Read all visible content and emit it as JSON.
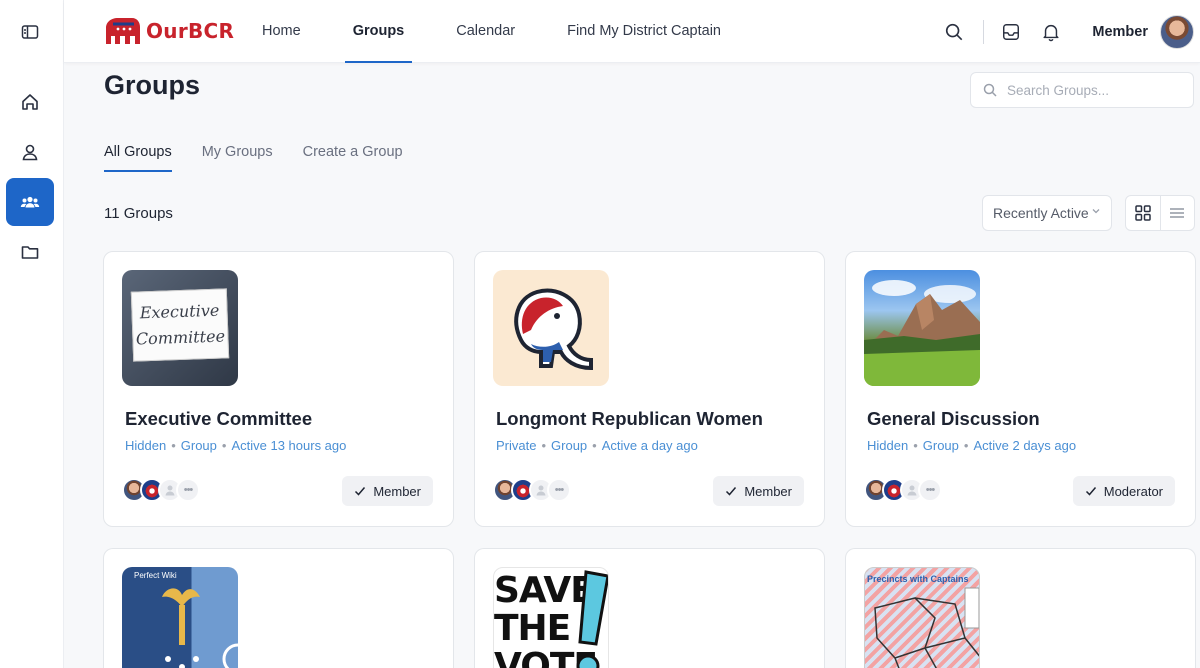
{
  "app": {
    "logo_text": "OurBCR"
  },
  "nav": {
    "items": [
      {
        "label": "Home",
        "active": false
      },
      {
        "label": "Groups",
        "active": true
      },
      {
        "label": "Calendar",
        "active": false
      },
      {
        "label": "Find My District Captain",
        "active": false
      }
    ]
  },
  "user": {
    "name": "Member"
  },
  "sidebar": {
    "items": [
      {
        "icon": "sidebar-toggle-icon"
      },
      {
        "icon": "home-icon"
      },
      {
        "icon": "profile-icon"
      },
      {
        "icon": "groups-icon",
        "active": true
      },
      {
        "icon": "folder-icon"
      }
    ]
  },
  "page": {
    "title": "Groups",
    "search_placeholder": "Search Groups...",
    "tabs": [
      {
        "label": "All Groups",
        "active": true
      },
      {
        "label": "My Groups",
        "active": false
      },
      {
        "label": "Create a Group",
        "active": false
      }
    ],
    "count_label": "11 Groups",
    "sort_label": "Recently Active"
  },
  "groups": [
    {
      "name": "Executive Committee",
      "privacy": "Hidden",
      "type": "Group",
      "activity": "Active 13 hours ago",
      "role": "Member",
      "thumb_text": [
        "Executive",
        "Committee"
      ]
    },
    {
      "name": "Longmont Republican Women",
      "privacy": "Private",
      "type": "Group",
      "activity": "Active a day ago",
      "role": "Member"
    },
    {
      "name": "General Discussion",
      "privacy": "Hidden",
      "type": "Group",
      "activity": "Active 2 days ago",
      "role": "Moderator"
    },
    {
      "thumb_text": [
        "Perfect Wiki"
      ]
    },
    {
      "thumb_text": [
        "SAVE",
        "THE",
        "VOTE"
      ]
    },
    {
      "thumb_text": [
        "Precincts with Captains"
      ]
    }
  ],
  "colors": {
    "accent": "#1e66c8",
    "brand_red": "#c8232c",
    "meta_blue": "#4a8fd4"
  }
}
